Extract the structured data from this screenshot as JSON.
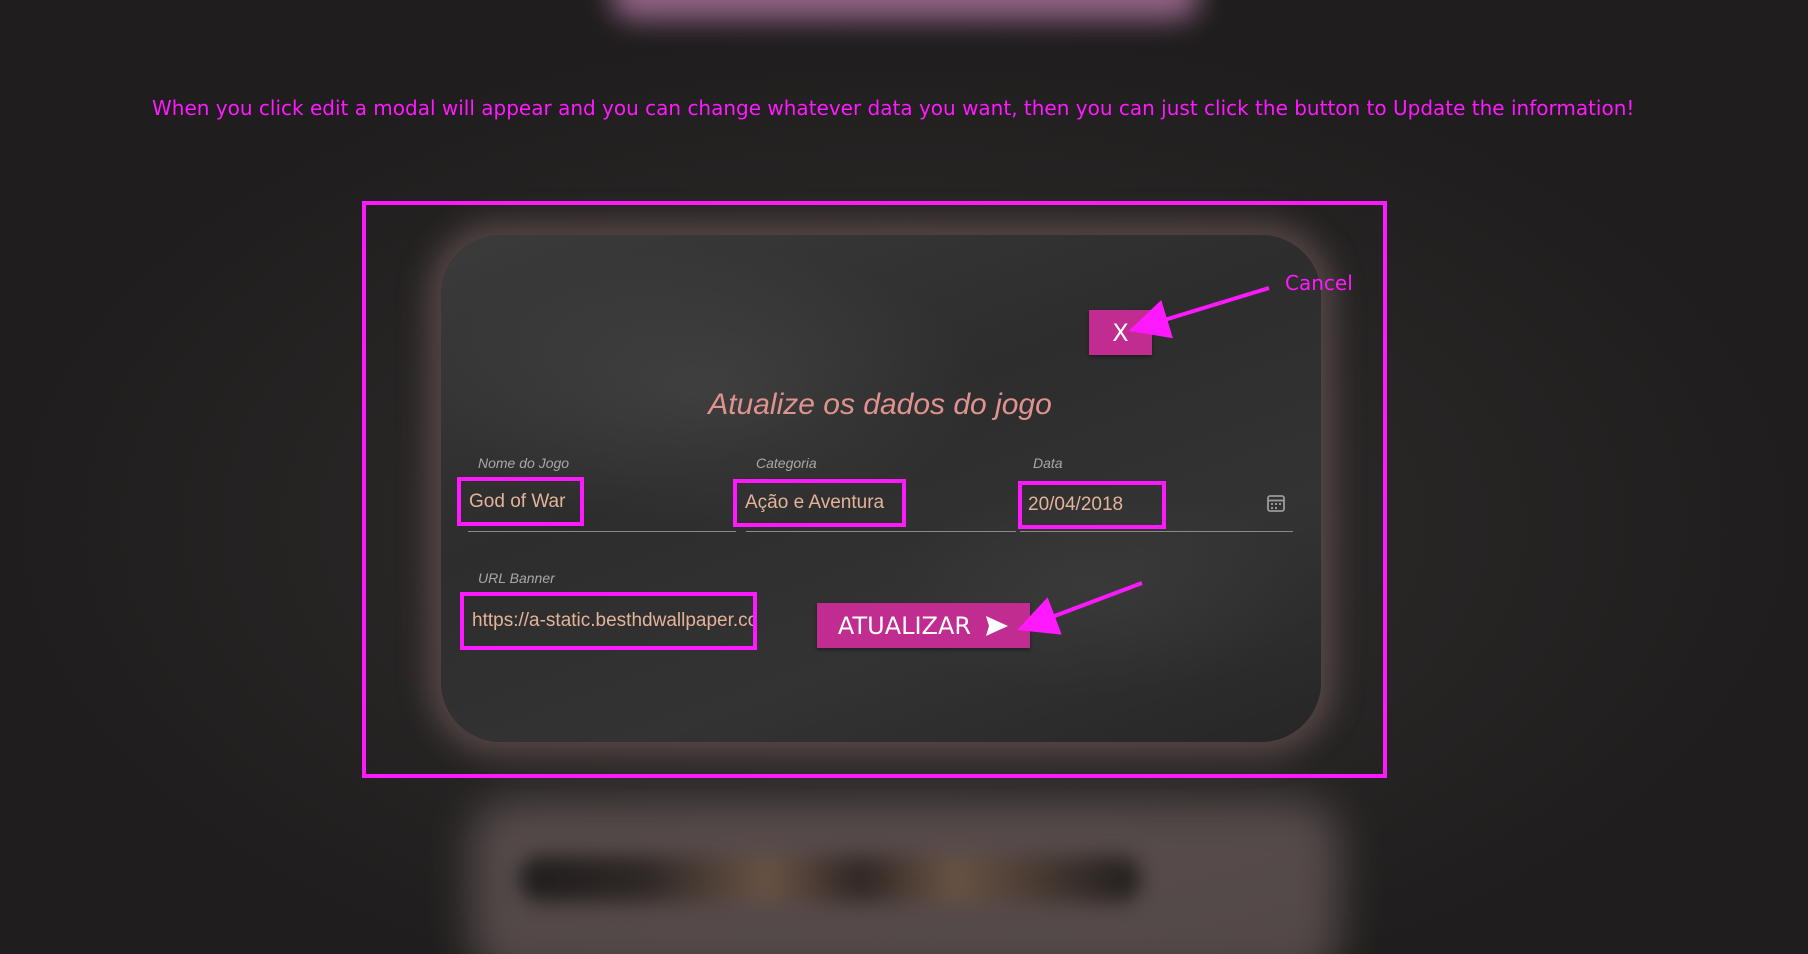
{
  "annotation": {
    "text": "When you click edit a modal will appear and you can change whatever data you want, then you can just click the button to Update the information!",
    "cancel_label": "Cancel"
  },
  "modal": {
    "close_label": "X",
    "title": "Atualize os dados do jogo",
    "fields": {
      "name": {
        "label": "Nome do Jogo",
        "value": "God of War"
      },
      "category": {
        "label": "Categoria",
        "value": "Ação e Aventura"
      },
      "date": {
        "label": "Data",
        "value": "20/04/2018"
      },
      "banner": {
        "label": "URL Banner",
        "value": "https://a-static.besthdwallpaper.com"
      }
    },
    "update_label": "ATUALIZAR"
  },
  "colors": {
    "annotation": "#ff19ff",
    "button": "#c02c8f",
    "title": "#e0938e",
    "field_text": "#e3b39a"
  },
  "icons": {
    "close": "close-icon",
    "calendar": "calendar-icon",
    "send": "send-icon"
  }
}
